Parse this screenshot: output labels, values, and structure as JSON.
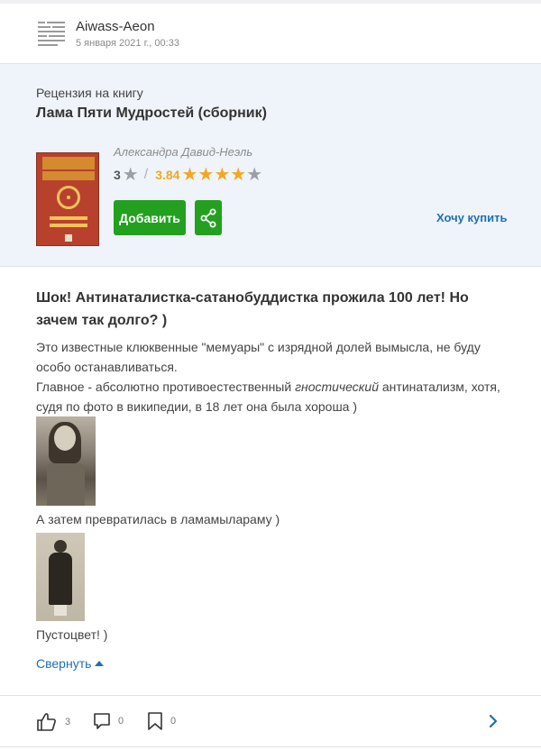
{
  "user": {
    "name": "Aiwass-Aeon",
    "date": "5 января 2021 г., 00:33"
  },
  "book": {
    "review_of": "Рецензия на книгу",
    "title": "Лама Пяти Мудростей (сборник)",
    "author": "Александра Давид-Неэль",
    "user_rating": "3",
    "avg_rating": "3.84",
    "avg_rating_value": 3.84,
    "add_label": "Добавить",
    "want_buy": "Хочу купить"
  },
  "review": {
    "title": "Шок! Антинаталистка-сатанобуддистка прожила 100 лет! Но зачем так долго? )",
    "p1": "Это известные клюквенные \"мемуары\" с изрядной долей вымысла, не буду особо останавливаться.",
    "p2_before": "Главное - абсолютно противоестественный ",
    "p2_italic": "гностический",
    "p2_after": " антинатализм, хотя, судя по фото в википедии, в 18 лет она была хороша )",
    "caption1": "А затем превратилась в ламамылараму )",
    "caption2": "Пустоцвет! )",
    "collapse_label": "Свернуть"
  },
  "footer": {
    "likes": "3",
    "comments": "0",
    "bookmarks": "0"
  },
  "colors": {
    "accent_green": "#23a01f",
    "link_blue": "#1f6fb4",
    "star_gold": "#f4a81f",
    "star_grey": "#9aa0a6",
    "book_block_bg": "#eef4fa"
  }
}
